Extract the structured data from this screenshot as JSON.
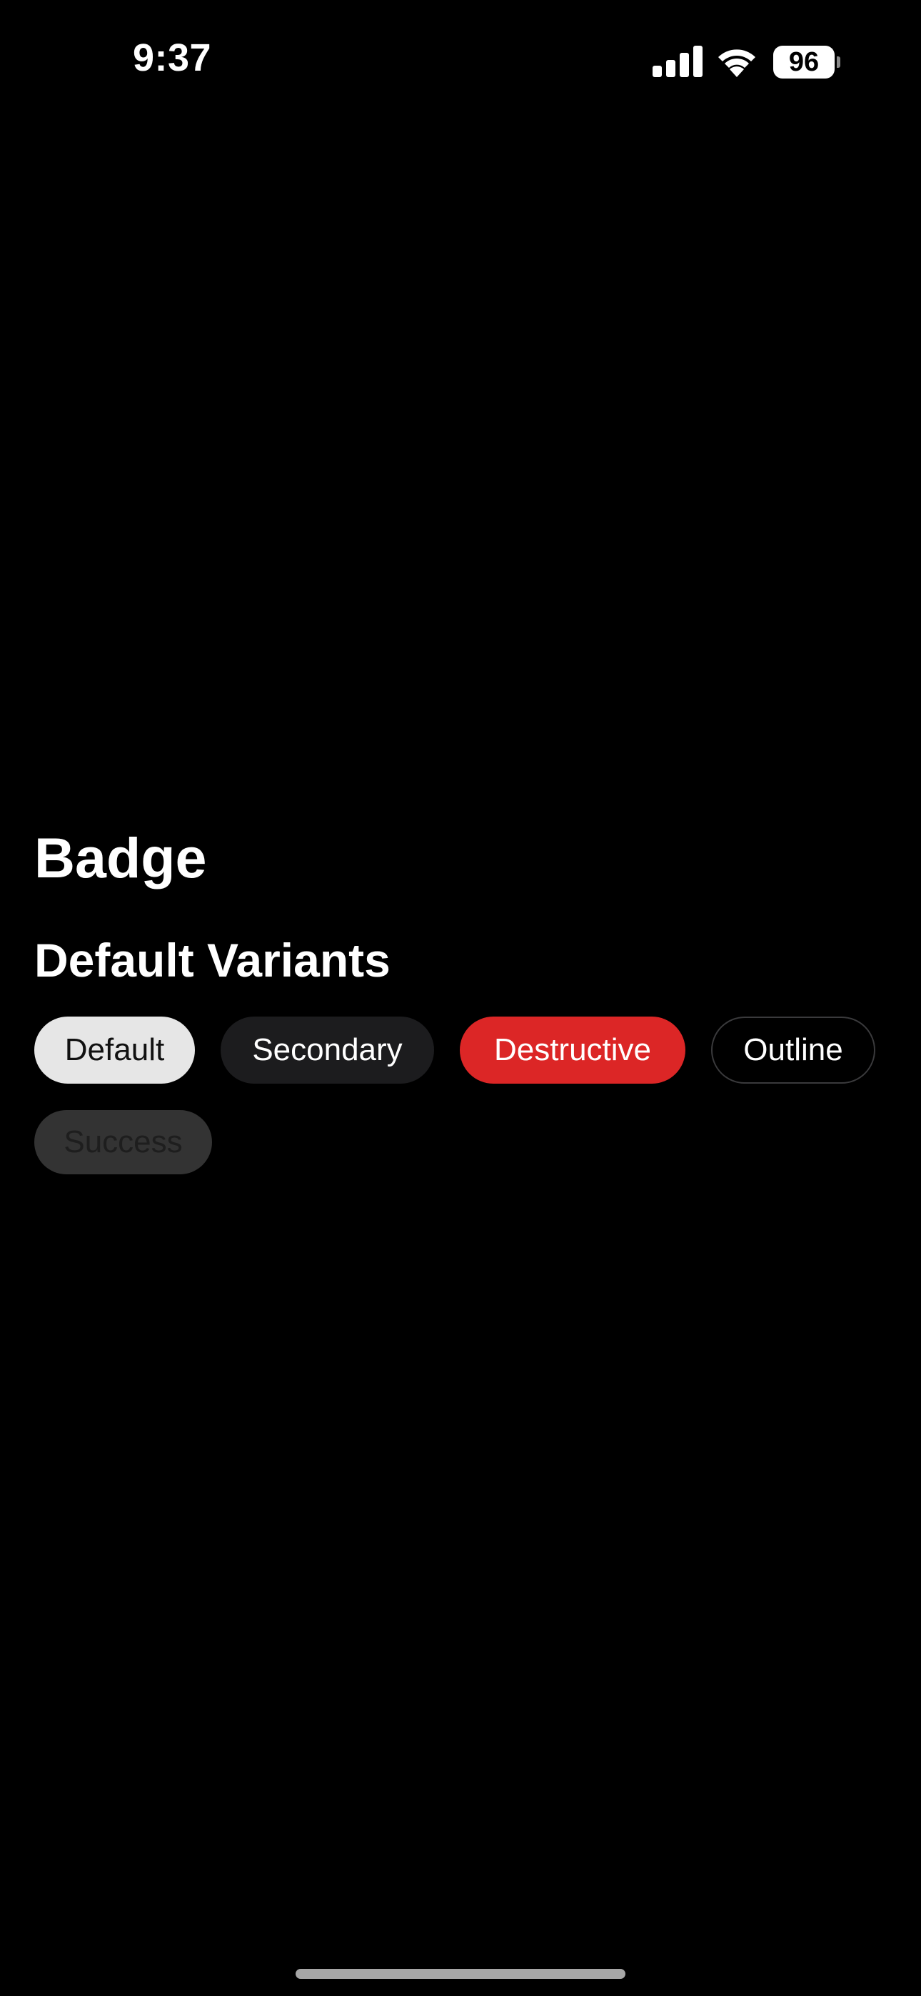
{
  "status_bar": {
    "time": "9:37",
    "battery_level": "96",
    "icons": [
      "signal-icon",
      "wifi-icon",
      "battery-icon"
    ]
  },
  "page": {
    "title": "Badge",
    "section_title": "Default Variants"
  },
  "badges": [
    {
      "label": "Default",
      "variant": "default",
      "background": "#e6e6e6",
      "text_color": "#111111"
    },
    {
      "label": "Secondary",
      "variant": "secondary",
      "background": "#1c1c1e",
      "text_color": "#ffffff"
    },
    {
      "label": "Destructive",
      "variant": "destructive",
      "background": "#dc2626",
      "text_color": "#ffffff"
    },
    {
      "label": "Outline",
      "variant": "outline",
      "background": "transparent",
      "text_color": "#ffffff"
    },
    {
      "label": "Success",
      "variant": "success",
      "background": "#333333",
      "text_color": "#1e1e1e"
    }
  ],
  "colors": {
    "background": "#000000",
    "foreground": "#ffffff",
    "destructive": "#dc2626"
  }
}
